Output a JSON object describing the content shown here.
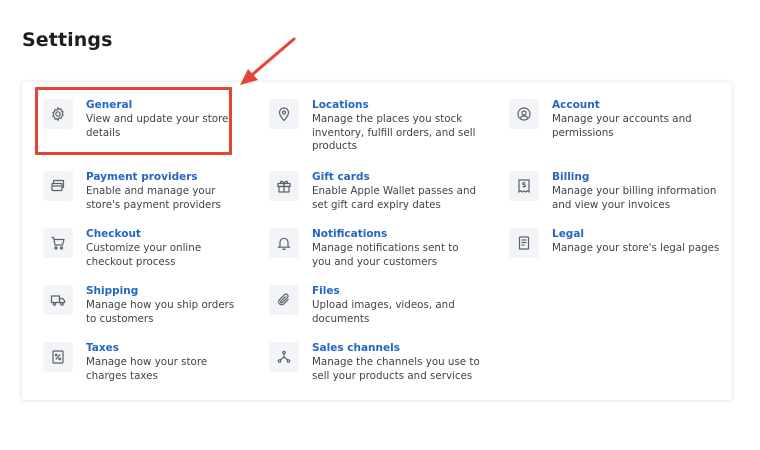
{
  "page": {
    "title": "Settings"
  },
  "colors": {
    "link": "#2466c4",
    "icon_bg": "#f2f4f7",
    "highlight": "#e64535"
  },
  "settings": {
    "columns": [
      [
        {
          "label": "General",
          "desc": "View and update your store details",
          "icon": "gear-icon"
        },
        {
          "label": "Payment providers",
          "desc": "Enable and manage your store's payment providers",
          "icon": "credit-card-icon"
        },
        {
          "label": "Checkout",
          "desc": "Customize your online checkout process",
          "icon": "cart-icon"
        },
        {
          "label": "Shipping",
          "desc": "Manage how you ship orders to customers",
          "icon": "truck-icon"
        },
        {
          "label": "Taxes",
          "desc": "Manage how your store charges taxes",
          "icon": "percent-receipt-icon"
        }
      ],
      [
        {
          "label": "Locations",
          "desc": "Manage the places you stock inventory, fulfill orders, and sell products",
          "icon": "location-pin-icon"
        },
        {
          "label": "Gift cards",
          "desc": "Enable Apple Wallet passes and set gift card expiry dates",
          "icon": "gift-icon"
        },
        {
          "label": "Notifications",
          "desc": "Manage notifications sent to you and your customers",
          "icon": "bell-icon"
        },
        {
          "label": "Files",
          "desc": "Upload images, videos, and documents",
          "icon": "paperclip-icon"
        },
        {
          "label": "Sales channels",
          "desc": "Manage the channels you use to sell your products and services",
          "icon": "channels-icon"
        }
      ],
      [
        {
          "label": "Account",
          "desc": "Manage your accounts and permissions",
          "icon": "account-icon"
        },
        {
          "label": "Billing",
          "desc": "Manage your billing information and view your invoices",
          "icon": "invoice-icon"
        },
        {
          "label": "Legal",
          "desc": "Manage your store's legal pages",
          "icon": "legal-document-icon"
        }
      ]
    ]
  },
  "annotation": {
    "highlighted_item": "General"
  }
}
